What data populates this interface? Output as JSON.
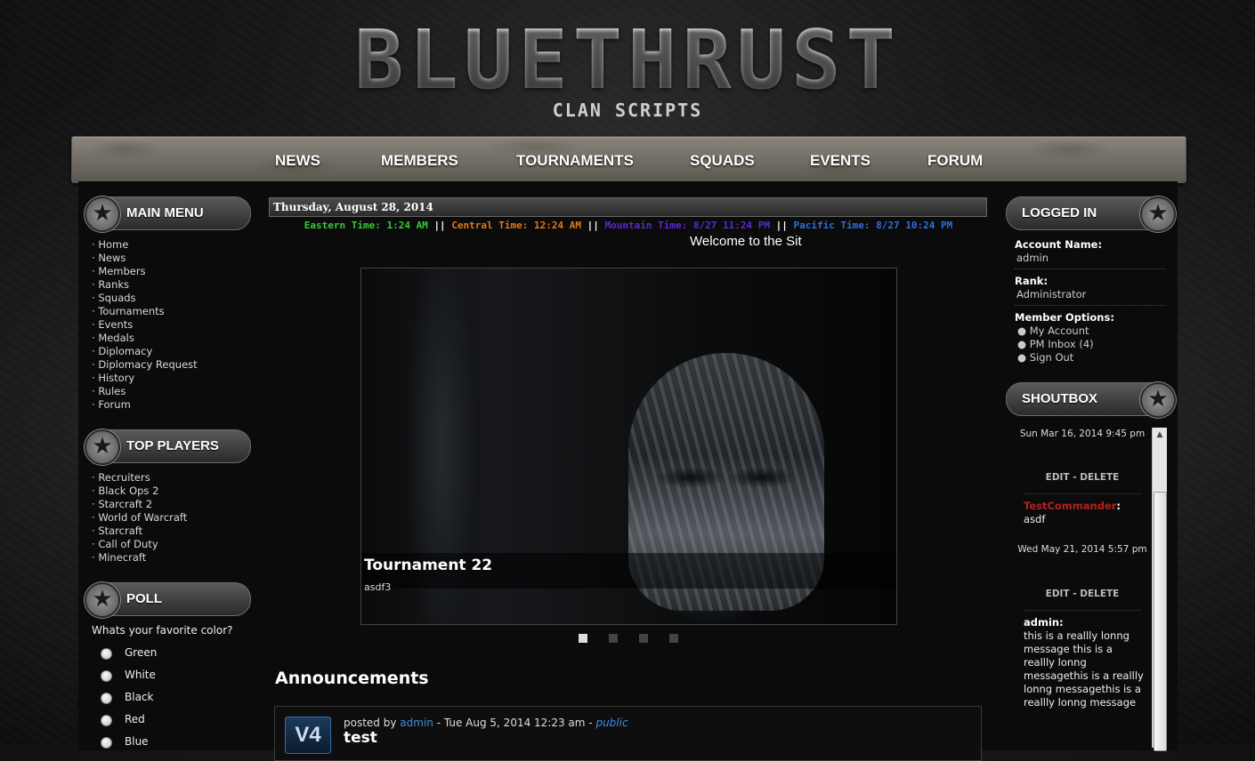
{
  "header": {
    "title": "BLUETHRUST",
    "subtitle": "CLAN SCRIPTS"
  },
  "nav": [
    "NEWS",
    "MEMBERS",
    "TOURNAMENTS",
    "SQUADS",
    "EVENTS",
    "FORUM"
  ],
  "main_menu": {
    "title": "MAIN MENU",
    "items": [
      "Home",
      "News",
      "Members",
      "Ranks",
      "Squads",
      "Tournaments",
      "Events",
      "Medals",
      "Diplomacy",
      "Diplomacy Request",
      "History",
      "Rules",
      "Forum"
    ]
  },
  "top_players": {
    "title": "TOP PLAYERS",
    "items": [
      "Recruiters",
      "Black Ops 2",
      "Starcraft 2",
      "World of Warcraft",
      "Starcraft",
      "Call of Duty",
      "Minecraft"
    ]
  },
  "poll": {
    "title": "POLL",
    "question": "Whats your favorite color?",
    "options": [
      "Green",
      "White",
      "Black",
      "Red",
      "Blue"
    ]
  },
  "date": "Thursday, August 28, 2014",
  "timezones": {
    "eastern": "Eastern Time: 1:24 AM",
    "central": "Central Time: 12:24 AM",
    "mountain": "Mountain Time: 8/27 11:24 PM",
    "pacific": "Pacific Time: 8/27 10:24 PM",
    "separator": "||",
    "colors": {
      "eastern": "#33cc33",
      "central": "#e07a10",
      "mountain": "#5a2ad0",
      "pacific": "#2f6fe0"
    }
  },
  "welcome": "Welcome to the Sit",
  "slide": {
    "title": "Tournament 22",
    "desc": "asdf3"
  },
  "announcements": {
    "title": "Announcements",
    "avatar_text": "V4",
    "posted_by": "posted by",
    "author": "admin",
    "date": "- Tue Aug 5, 2014 12:23 am -",
    "visibility": "public",
    "post_title": "test"
  },
  "logged_in": {
    "title": "LOGGED IN",
    "account_label": "Account Name:",
    "account": "admin",
    "rank_label": "Rank:",
    "rank": "Administrator",
    "options_label": "Member Options:",
    "options": [
      "My Account",
      "PM Inbox (4)",
      "Sign Out"
    ]
  },
  "shoutbox": {
    "title": "SHOUTBOX",
    "edit_delete": "EDIT - DELETE",
    "entries": [
      {
        "date": "Sun Mar 16, 2014 9:45 pm"
      },
      {
        "name": "TestCommander",
        "name_color": "#b02222",
        "colon": ":",
        "message": "asdf",
        "date": "Wed May 21, 2014 5:57 pm"
      },
      {
        "name": "admin",
        "name_color": "#ffffff",
        "colon": ":",
        "message": "this is a reallly lonng message this is a reallly lonng messagethis is a reallly lonng messagethis is a reallly lonng message"
      }
    ]
  }
}
